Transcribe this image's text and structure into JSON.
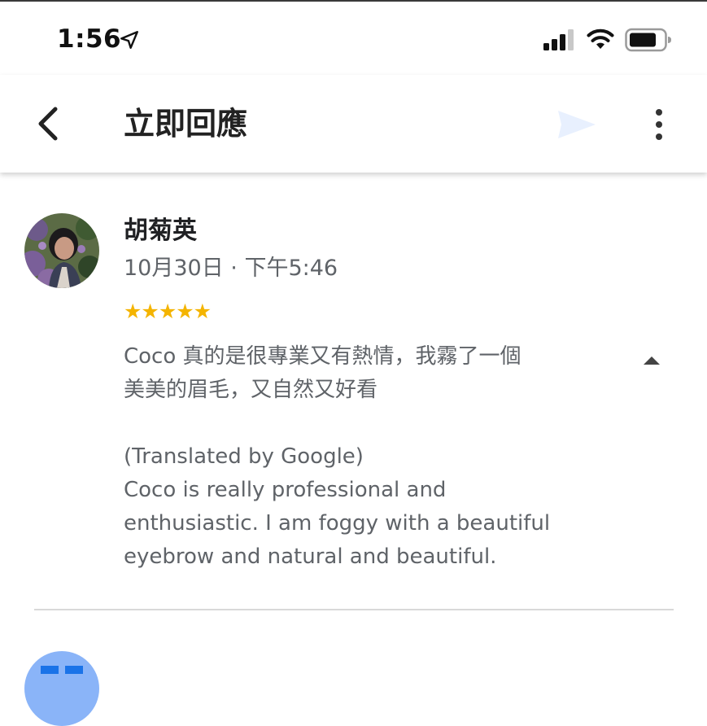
{
  "status_bar": {
    "time": "1:56",
    "icons": [
      "location-arrow-icon",
      "cellular-signal-icon",
      "wifi-icon",
      "battery-icon"
    ]
  },
  "app_bar": {
    "title": "立即回應",
    "back_icon": "chevron-left-icon",
    "send_icon": "send-icon",
    "more_icon": "more-vert-icon"
  },
  "review": {
    "reviewer_name": "胡菊英",
    "date": "10月30日 · 下午5:46",
    "stars_display": "★★★★★",
    "rating": 5,
    "original_text": "Coco 真的是很專業又有熱情，我霧了一個\n美美的眉毛，又自然又好看",
    "translation_label": "(Translated by Google)",
    "translated_text": "Coco is really professional and\nenthusiastic. I am foggy with a beautiful\neyebrow and natural and beautiful.",
    "collapse_icon": "arrow-up-icon"
  },
  "colors": {
    "star": "#f4b400",
    "secondary_text": "#5f6368",
    "primary_text": "#202124",
    "send_icon_disabled": "#e8f0fe",
    "next_avatar_bg": "#8ab4f8",
    "next_avatar_fg": "#1a73e8"
  }
}
